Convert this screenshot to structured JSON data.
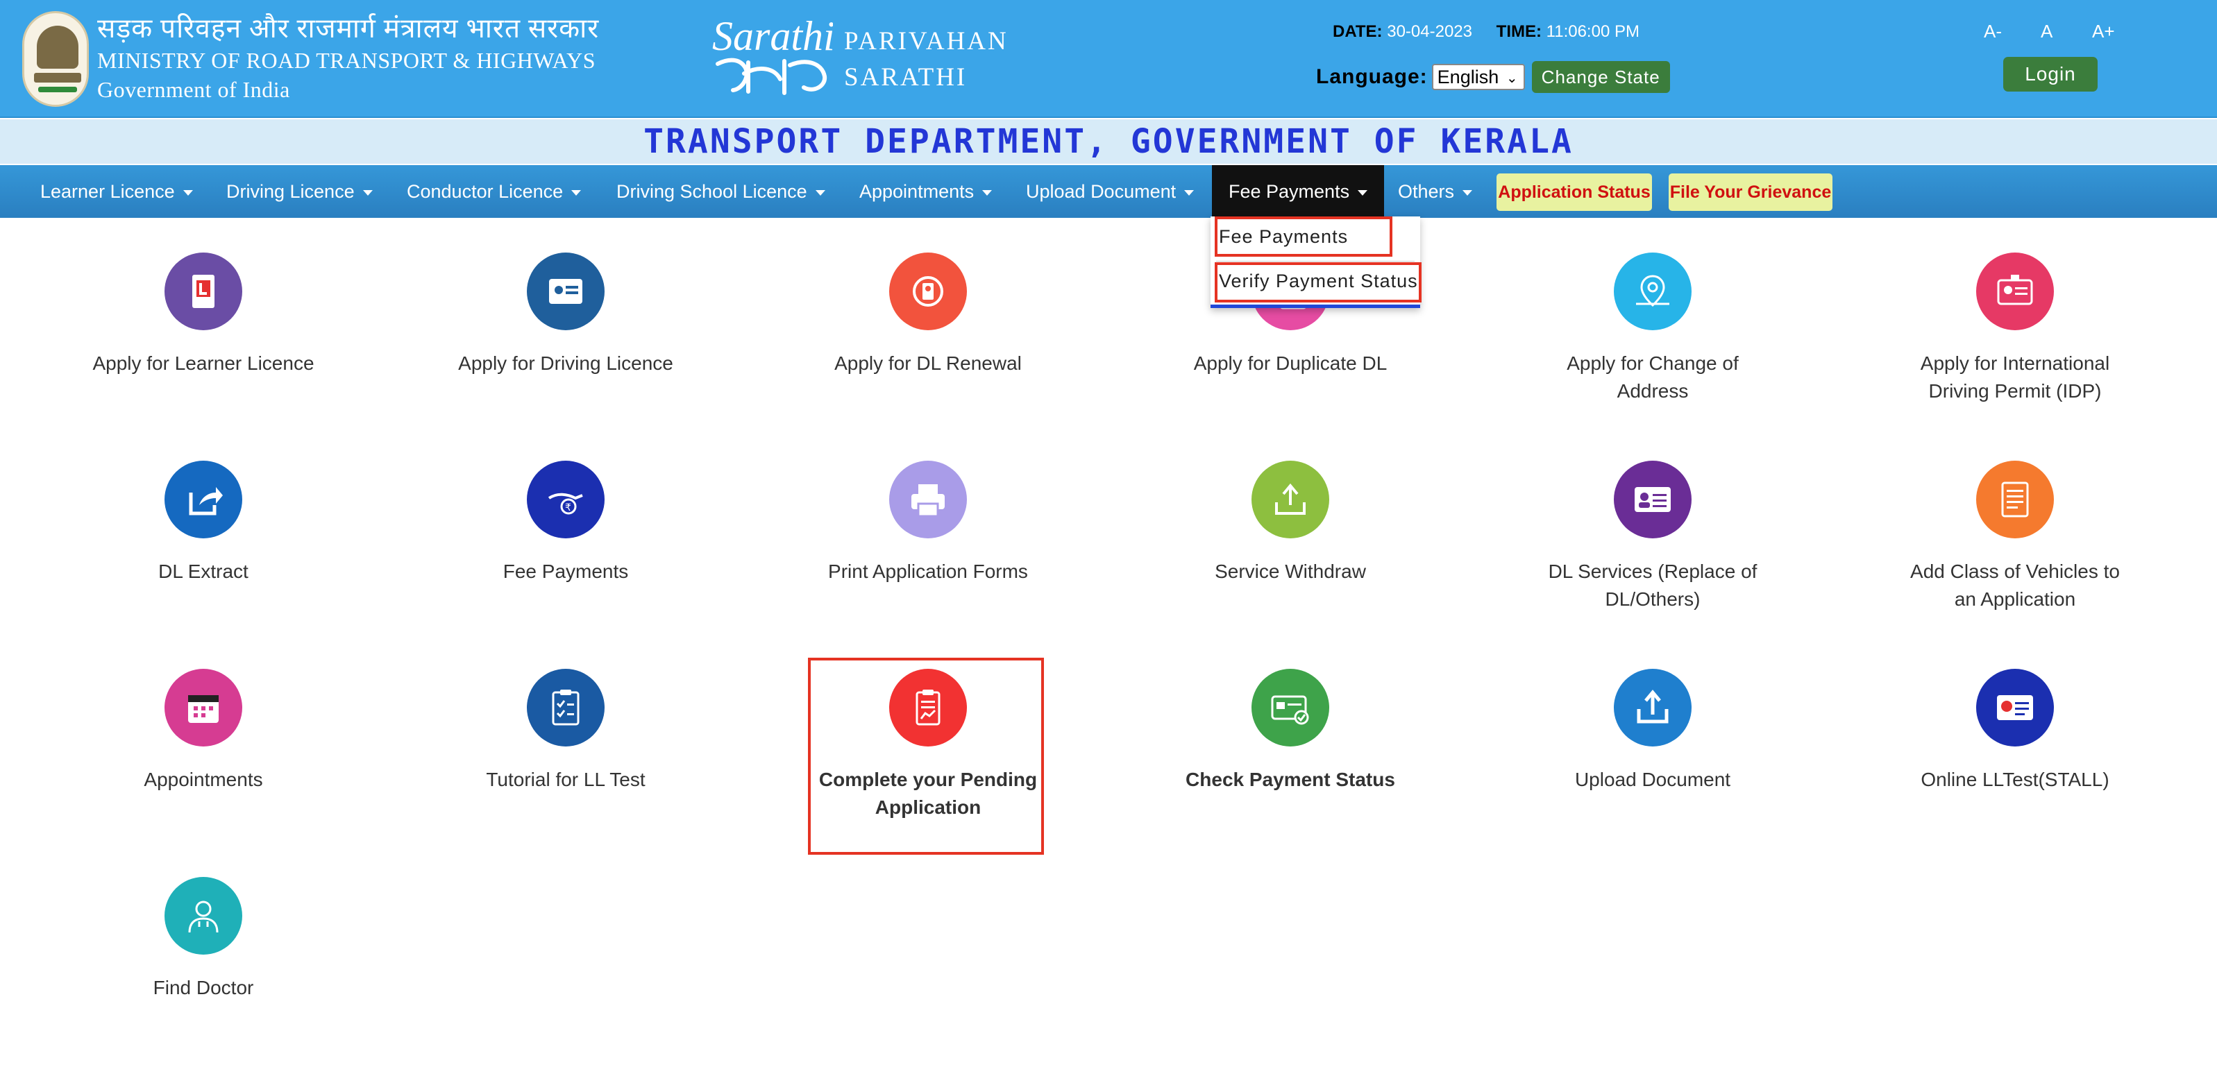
{
  "header": {
    "hindi_title": "सड़क परिवहन और राजमार्ग मंत्रालय भारत सरकार",
    "ministry": "MINISTRY OF ROAD TRANSPORT & HIGHWAYS",
    "government": "Government of India",
    "logo_script": "Sarathi",
    "brand_line1": "PARIVAHAN",
    "brand_line2": "SARATHI",
    "date_label": "DATE:",
    "date_value": "30-04-2023",
    "time_label": "TIME:",
    "time_value": "11:06:00 PM",
    "language_label": "Language:",
    "language_selected": "English",
    "change_state": "Change State",
    "font_decrease": "A-",
    "font_normal": "A",
    "font_increase": "A+",
    "login": "Login"
  },
  "department": "TRANSPORT DEPARTMENT, GOVERNMENT OF KERALA",
  "nav": {
    "items": [
      {
        "label": "Learner Licence"
      },
      {
        "label": "Driving Licence"
      },
      {
        "label": "Conductor Licence"
      },
      {
        "label": "Driving School Licence"
      },
      {
        "label": "Appointments"
      },
      {
        "label": "Upload Document"
      },
      {
        "label": "Fee Payments",
        "active": true
      },
      {
        "label": "Others"
      }
    ],
    "application_status": "Application Status",
    "grievance": "File Your Grievance"
  },
  "dropdown": {
    "items": [
      {
        "label": "Fee Payments"
      },
      {
        "label": "Verify Payment Status"
      }
    ]
  },
  "tiles": [
    {
      "label": "Apply for Learner Licence",
      "icon": "learner-licence-icon",
      "color": "#6a4da5"
    },
    {
      "label": "Apply for Driving Licence",
      "icon": "driving-licence-icon",
      "color": "#1f5f9c"
    },
    {
      "label": "Apply for DL Renewal",
      "icon": "dl-renewal-icon",
      "color": "#f2533d"
    },
    {
      "label": "Apply for Duplicate DL",
      "icon": "duplicate-dl-icon",
      "color": "#e64ca3"
    },
    {
      "label": "Apply for Change of Address",
      "icon": "location-pin-icon",
      "color": "#27b4e8"
    },
    {
      "label": "Apply for International Driving Permit (IDP)",
      "icon": "idp-icon",
      "color": "#e63965"
    },
    {
      "label": "DL Extract",
      "icon": "share-arrow-icon",
      "color": "#1569c0"
    },
    {
      "label": "Fee Payments",
      "icon": "hand-rupee-icon",
      "color": "#1b2fb0"
    },
    {
      "label": "Print Application Forms",
      "icon": "printer-icon",
      "color": "#a99ce8"
    },
    {
      "label": "Service Withdraw",
      "icon": "withdraw-tray-icon",
      "color": "#8dbf3f"
    },
    {
      "label": "DL Services (Replace of DL/Others)",
      "icon": "id-card-icon",
      "color": "#6a2d96"
    },
    {
      "label": "Add Class of Vehicles to an Application",
      "icon": "document-list-icon",
      "color": "#f57a2e"
    },
    {
      "label": "Appointments",
      "icon": "calendar-icon",
      "color": "#d63c92"
    },
    {
      "label": "Tutorial for LL Test",
      "icon": "checklist-icon",
      "color": "#1a5aa3"
    },
    {
      "label": "Complete your Pending Application",
      "icon": "clipboard-chart-icon",
      "color": "#f23232",
      "bold": true
    },
    {
      "label": "Check Payment Status",
      "icon": "payment-card-check-icon",
      "color": "#3ea34a",
      "bold": true
    },
    {
      "label": "Upload Document",
      "icon": "upload-tray-icon",
      "color": "#1f7fce"
    },
    {
      "label": "Online LLTest(STALL)",
      "icon": "online-test-icon",
      "color": "#1b2fb0"
    },
    {
      "label": "Find Doctor",
      "icon": "doctor-icon",
      "color": "#1fb0b8"
    }
  ]
}
